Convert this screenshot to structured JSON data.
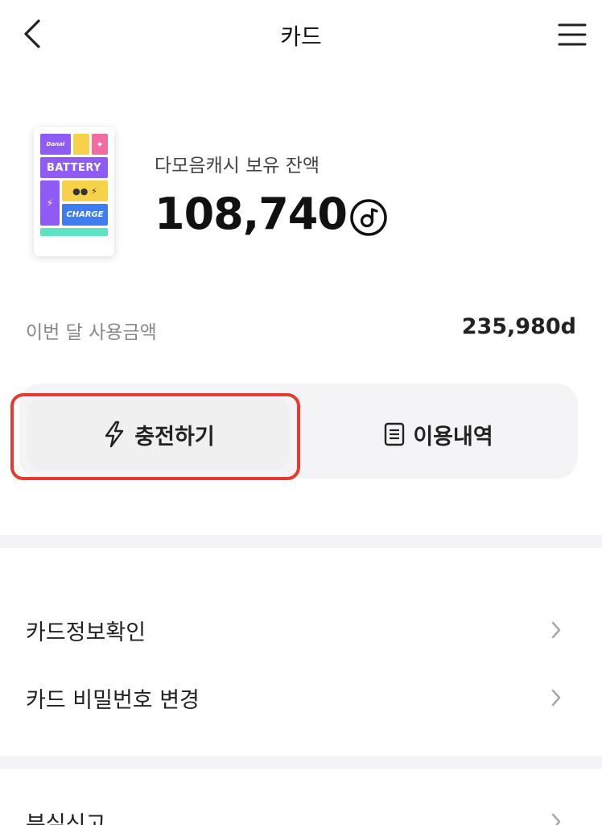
{
  "header": {
    "title": "카드",
    "back_icon": "chevron-left-icon",
    "menu_icon": "hamburger-menu-icon"
  },
  "card": {
    "logo_text": "Danal",
    "battery_text": "BATTERY",
    "charge_text": "CHARGE",
    "colors": {
      "purple": "#8e5cf5",
      "pink": "#f06ba0",
      "yellow": "#f5d24a",
      "blue": "#3e7cf0",
      "mint": "#5ee3c2"
    }
  },
  "balance": {
    "label": "다모음캐시 보유 잔액",
    "amount": "108,740",
    "currency_icon": "d-coin-icon"
  },
  "usage": {
    "label": "이번 달 사용금액",
    "value": "235,980d"
  },
  "actions": {
    "charge_label": "충전하기",
    "charge_icon": "lightning-icon",
    "history_label": "이용내역",
    "history_icon": "document-list-icon",
    "highlight_color": "#e53a2f"
  },
  "menu": {
    "items": [
      {
        "label": "카드정보확인"
      },
      {
        "label": "카드 비밀번호 변경"
      },
      {
        "label": "분실신고"
      }
    ],
    "chevron_icon": "chevron-right-icon"
  }
}
